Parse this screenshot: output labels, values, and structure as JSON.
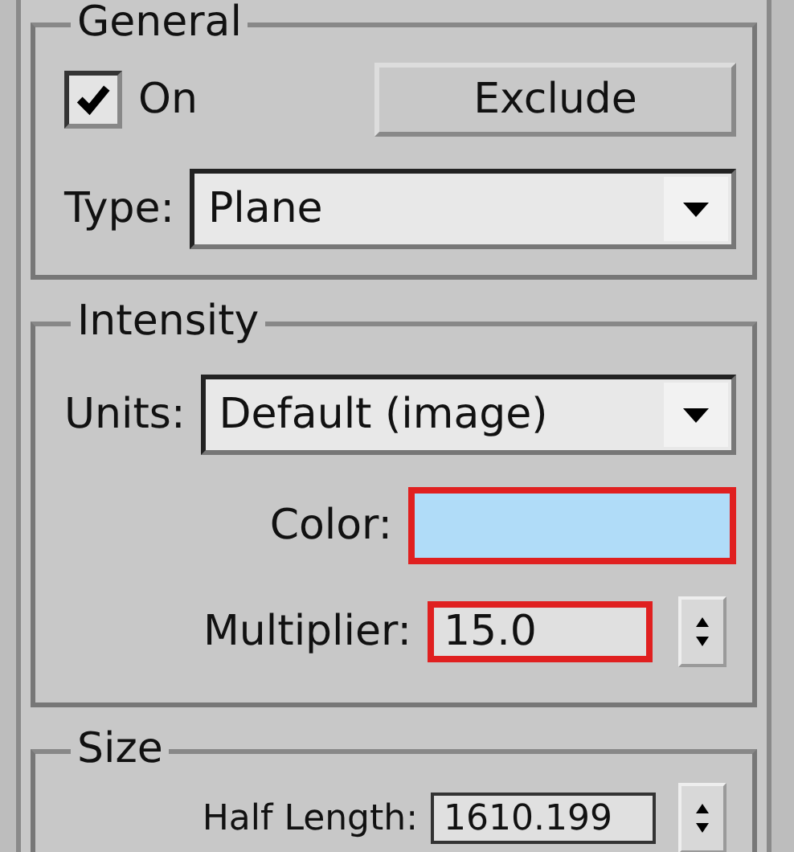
{
  "general": {
    "title": "General",
    "on": {
      "label": "On",
      "checked": true
    },
    "exclude_button": "Exclude",
    "type": {
      "label": "Type:",
      "value": "Plane"
    }
  },
  "intensity": {
    "title": "Intensity",
    "units": {
      "label": "Units:",
      "value": "Default (image)"
    },
    "color": {
      "label": "Color:",
      "color": "#b0dcf8",
      "highlighted": true
    },
    "multiplier": {
      "label": "Multiplier:",
      "value": "15.0",
      "highlighted": true
    }
  },
  "size": {
    "title": "Size",
    "half_length": {
      "label": "Half Length:",
      "value": "1610.199"
    }
  }
}
